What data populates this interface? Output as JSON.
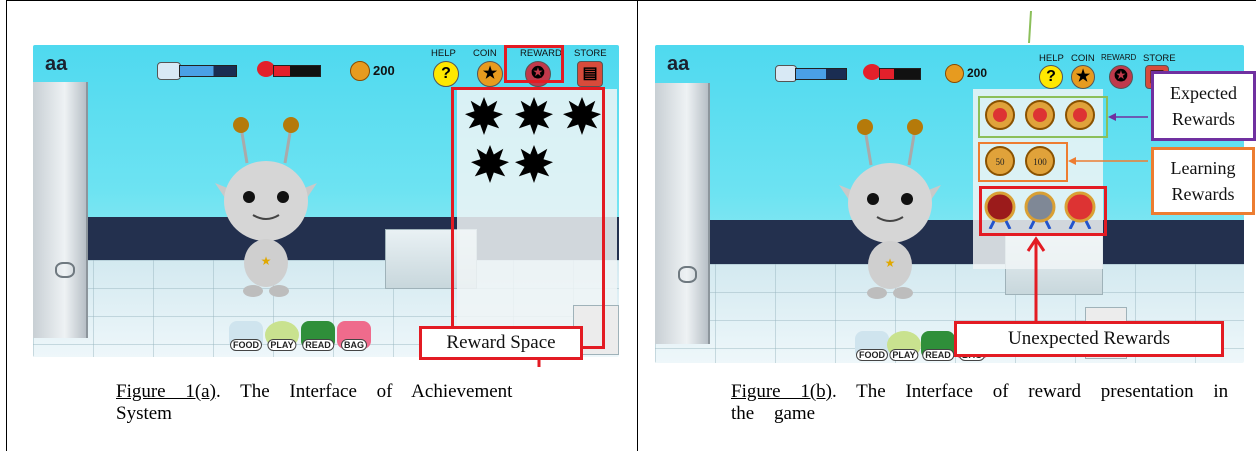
{
  "figure_a": {
    "game": {
      "player_name": "aa",
      "coins": "200",
      "top_menu": [
        "HELP",
        "COIN",
        "REWARD",
        "STORE"
      ],
      "bottom_menu": [
        "FOOD",
        "PLAY",
        "READ",
        "BAG"
      ],
      "reward_slots_locked": 5
    },
    "callout": "Reward Space",
    "caption_label": "Figure 1(a)",
    "caption_text": ". The Interface of Achievement System"
  },
  "figure_b": {
    "game": {
      "player_name": "aa",
      "coins": "200",
      "top_menu": [
        "HELP",
        "COIN",
        "REWARD",
        "STORE"
      ],
      "bottom_menu": [
        "FOOD",
        "PLAY",
        "READ",
        "BAG"
      ]
    },
    "callouts": {
      "expected": "Expected Rewards",
      "learning": "Learning Rewards",
      "unexpected": "Unexpected Rewards"
    },
    "caption_label": "Figure 1(b)",
    "caption_text": ". The Interface of reward presentation in the game"
  },
  "colors": {
    "highlight_red": "#e31b23",
    "expected_purple": "#7030a0",
    "learning_orange": "#ed7d31",
    "expected_green": "#8bbf5a"
  },
  "icons": {
    "help": "question-mark-icon",
    "coin": "star-coin-icon",
    "reward": "medal-icon",
    "store": "store-icon",
    "water": "water-meter-icon",
    "health": "heart-icon",
    "locked_reward": "black-burst-icon"
  }
}
